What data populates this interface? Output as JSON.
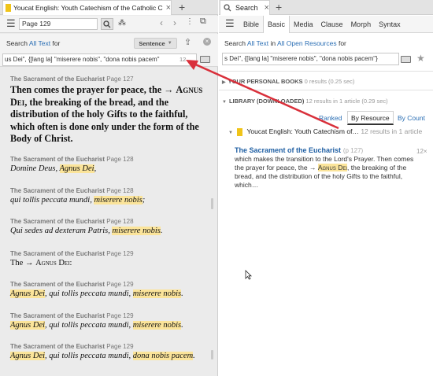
{
  "left": {
    "tab_title": "Youcat English: Youth Catechism of the Catholic Church",
    "close_glyph": "×",
    "plus_glyph": "+",
    "page_field": "Page 129",
    "search": {
      "label_prefix": "Search",
      "label_link": "All Text",
      "label_suffix": "for",
      "sentence_label": "Sentence",
      "query": "us Dei\", {[lang la] \"miserere nobis\", \"dona nobis pacem\"",
      "count": "12"
    },
    "first_text": "Then comes the prayer for peace, the → Agnus Dei, the breaking of the bread, and the distribution of the holy Gifts to the faithful, which often is done only under the form of the Body of Christ.",
    "first_text_parts": {
      "a": "Then comes the prayer for peace, the → ",
      "sc": "Agnus Dei",
      "b": ", the breaking of the bread, and the distribution of the holy Gifts to the faithful, which often is done only under the form of the Body of Christ."
    },
    "results": [
      {
        "ref": "The Sacrament of the Eucharist",
        "page": "Page 127"
      },
      {
        "ref": "The Sacrament of the Eucharist",
        "page": "Page 128",
        "pre": "Domine Deus, ",
        "hl": "Agnus Dei",
        "post": ","
      },
      {
        "ref": "The Sacrament of the Eucharist",
        "page": "Page 128",
        "pre": "qui tollis peccata mundi, ",
        "hl": "miserere nobis",
        "post": ";"
      },
      {
        "ref": "The Sacrament of the Eucharist",
        "page": "Page 128",
        "pre": "Qui sedes ad dexteram Patris, ",
        "hl": "miserere nobis",
        "post": "."
      },
      {
        "ref": "The Sacrament of the Eucharist",
        "page": "Page 129",
        "pre": "The → ",
        "sc": "Agnus Dei",
        "post": ":"
      },
      {
        "ref": "The Sacrament of the Eucharist",
        "page": "Page 129",
        "hl_first": "Agnus Dei",
        "mid": ", qui tollis peccata mundi, ",
        "hl": "miserere nobis",
        "post": "."
      },
      {
        "ref": "The Sacrament of the Eucharist",
        "page": "Page 129",
        "hl_first": "Agnus Dei",
        "mid": ", qui tollis peccata mundi, ",
        "hl": "miserere nobis",
        "post": "."
      },
      {
        "ref": "The Sacrament of the Eucharist",
        "page": "Page 129",
        "hl_first": "Agnus Dei",
        "mid": ", qui tollis peccata mundi, ",
        "hl": "dona nobis pacem",
        "post": "."
      }
    ]
  },
  "right": {
    "tab_title": "Search",
    "close_glyph": "×",
    "plus_glyph": "+",
    "type_tabs": [
      "Bible",
      "Basic",
      "Media",
      "Clause",
      "Morph",
      "Syntax"
    ],
    "active_tab": "Basic",
    "search_label": {
      "prefix": "Search",
      "link1": "All Text",
      "mid": "in",
      "link2": "All Open Resources",
      "suffix": "for"
    },
    "query": "s Dei\", {[lang la] \"miserere nobis\", \"dona nobis pacem\"}",
    "personal_books": {
      "label": "YOUR PERSONAL BOOKS",
      "meta": "0 results (0.25 sec)"
    },
    "library": {
      "label": "LIBRARY (DOWNLOADED)",
      "meta": "12 results in 1 article (0.29 sec)"
    },
    "view_buttons": [
      "Ranked",
      "By Resource",
      "By Count"
    ],
    "resource": {
      "title": "Youcat English: Youth Catechism of…",
      "meta": "12 results in 1 article"
    },
    "result": {
      "title": "The Sacrament of the Eucharist",
      "page": "(p 127)",
      "count": "12×",
      "line1": "which makes the transition to the Lord's Prayer. Then comes",
      "line2_pre": "the prayer for peace, the → ",
      "line2_hl": "Agnus Dei",
      "line2_post": ", the breaking of the",
      "line3": "bread, and the distribution of the holy Gifts to the faithful,",
      "line4": "which…"
    }
  },
  "colors": {
    "highlight": "#fbe49a",
    "link": "#2a6eb4",
    "annotation_arrow": "#d9303b"
  }
}
